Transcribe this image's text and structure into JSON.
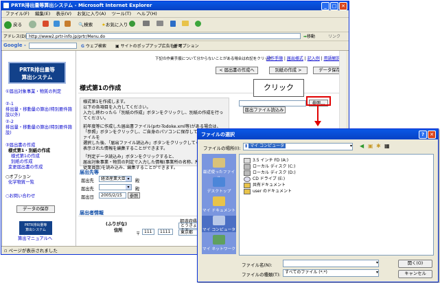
{
  "window": {
    "title": "PRTR排出量等算出システム - Microsoft Internet Explorer"
  },
  "menu": [
    "ファイル(F)",
    "編集(E)",
    "表示(V)",
    "お気に入り(A)",
    "ツール(T)",
    "ヘルプ(H)"
  ],
  "toolbar": {
    "back": "戻る",
    "search": "検索",
    "favorites": "お気に入り"
  },
  "address": {
    "label": "アドレス(D)",
    "url": "http://www2.prtr-info.jp/prtr/Menu.do",
    "go": "移動",
    "links": "リンク"
  },
  "google": {
    "label": "Google -",
    "search": "ウェブ検索",
    "popup": "サイトのポップアップ広告を許可",
    "options": "オプション"
  },
  "logo": {
    "line1": "PRTR排出量等",
    "line2": "算出システム"
  },
  "sidebar": {
    "items": [
      "①届出対象事業・物質の判定",
      "②-1",
      "排出量・移動量の算出(特別要件施設以外)",
      "②-2",
      "排出量・移動量の算出(特別要件施設)",
      "③届出書の作成",
      "様式第1・別紙の作成",
      "様式第1の作成",
      "別紙の作成",
      "変更届出書の作成",
      "○オプション",
      "化学物質一覧",
      "○お問い合わせ"
    ],
    "save_button": "データの保存",
    "small_logo_line1": "PRTR排出量等",
    "small_logo_line2": "算出システム",
    "manual_link": "算出マニュアルへ"
  },
  "topnav": {
    "notice": "下記の作業手順について分からないことがある場合は右記をクリック",
    "links": [
      "操作手順",
      "届出様式",
      "記入例",
      "用語解説"
    ],
    "buttons": [
      "< 届出書の作成へ",
      "別紙の作成 >",
      "データ保存"
    ]
  },
  "main": {
    "title": "様式第1の作成",
    "info_lines": [
      "様式第1を作成します。",
      "以下の各項目を入力してください。",
      "入力し終わったら「別紙の作成」ボタンをクリックし、別紙の作成を行ってください。",
      "",
      "前年度等に作成した届出書ファイル(prtr-Todoke.xml等)がある場合は、",
      "「参照」ボタンをクリックし、ご自身のパソコンに保存してある届出書ファイルを",
      "選択した後、「届出ファイル読込み」ボタンをクリックしてください。",
      "表示された情報を編集することができます。",
      "",
      "「判定データ読込み」ボタンをクリックすると、",
      "届出対象事業・物質の判定で入力した情報(事業所の名称、所在地、業種",
      "従業員数)を読み込み、編集することができます。"
    ],
    "browse_button": "参照...",
    "load_file_button": "届出ファイル読込み",
    "callout": "クリック",
    "dest_section": "届出先等",
    "dest_label": "届出先",
    "dest_value": "経済産業大臣",
    "dest_suffix": "殿",
    "dest2_label": "届出先",
    "dest2_suffix": "殿",
    "date_label": "届出日",
    "date_value": "2005/2/15",
    "date_ref": "参照",
    "reporter_section": "届出者情報",
    "furigana": "(ふりがな)",
    "address_label": "住所",
    "postal_mark": "〒",
    "postal1": "111",
    "postal2": "1111",
    "pref_label": "都道府県",
    "pref_furigana": "とうきょうと",
    "pref_value": "東京都"
  },
  "status": {
    "text": "ページが表示されました"
  },
  "dialog": {
    "title": "ファイルの選択",
    "lookin_label": "ファイルの場所(I):",
    "lookin_value": "マイ コンピュータ",
    "places": [
      "最近使ったファイル",
      "デスクトップ",
      "マイ ドキュメント",
      "マイ コンピュータ",
      "マイ ネットワーク"
    ],
    "files": [
      "3.5 インチ FD (A:)",
      "ローカル ディスク (C:)",
      "ローカル ディスク (D:)",
      "CD ドライブ (E:)",
      "共有ドキュメント",
      "user のドキュメント"
    ],
    "filename_label": "ファイル名(N):",
    "filetype_label": "ファイルの種類(T):",
    "filetype_value": "すべてのファイル (*.*)",
    "open_button": "開く(O)",
    "cancel_button": "キャンセル"
  },
  "colors": {
    "accent": "#e00000",
    "titlebar": "#0a58e6",
    "sidebar_logo": "#12418a"
  }
}
